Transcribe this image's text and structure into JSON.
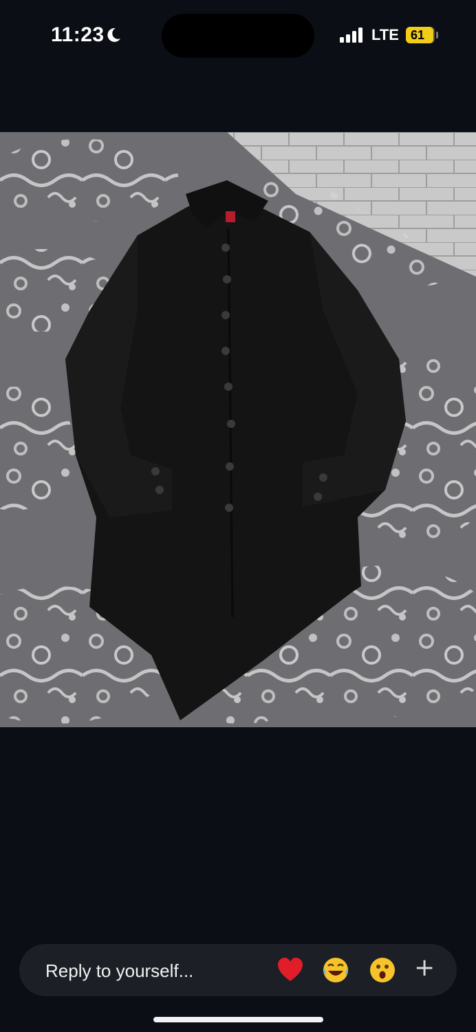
{
  "status_bar": {
    "time": "11:23",
    "network": "LTE",
    "battery": "61",
    "icons": [
      "moon-icon",
      "signal-icon",
      "battery-icon"
    ]
  },
  "story": {
    "image_alt": "Black long button-up shirt laid flat on a patterned gray rug"
  },
  "reply_bar": {
    "placeholder": "Reply to yourself...",
    "reactions": [
      "heart",
      "laugh",
      "wow"
    ],
    "add_label": "+"
  },
  "colors": {
    "background": "#0b0e14",
    "battery": "#f1cc18",
    "reply_bar": "#1c1f26"
  }
}
